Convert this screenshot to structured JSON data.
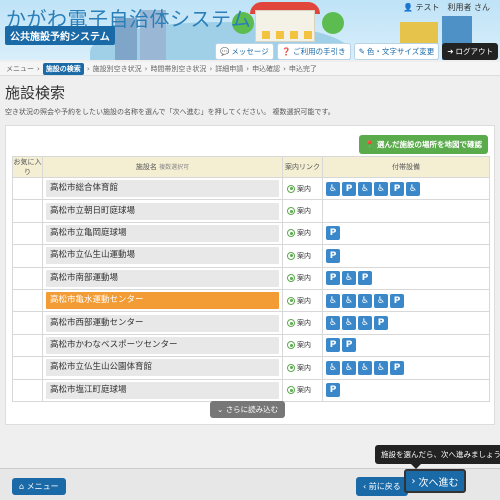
{
  "header": {
    "title": "かがわ電子自治体システム",
    "subtitle": "公共施設予約システム",
    "user": "テスト　利用者 さん",
    "buttons": {
      "message": "メッセージ",
      "notice": "ご利用の手引き",
      "color": "色・文字サイズ変更",
      "logout": "ログアウト"
    }
  },
  "breadcrumb": [
    "メニュー",
    "施設の検索",
    "施設別空き状況",
    "時間帯別空き状況",
    "詳細申請",
    "申込確認",
    "申込完了"
  ],
  "page": {
    "title": "施設検索",
    "instruction": "空き状況の照会や予約をしたい施設の名称を選んで「次へ進む」を押してください。 複数選択可能です。"
  },
  "map_button": "選んだ施設の場所を地図で確認",
  "table": {
    "headers": {
      "fav": "お気に入り",
      "name": "施設名",
      "name_sub": "複数選択可",
      "map": "案内リンク",
      "equipment": "付帯設備"
    },
    "map_link_label": "案内",
    "rows": [
      {
        "name": "高松市総合体育館",
        "equipment": [
          "♿",
          "P",
          "♿",
          "♿",
          "P",
          "♿"
        ],
        "selected": false
      },
      {
        "name": "高松市立朝日町庭球場",
        "equipment": [],
        "selected": false
      },
      {
        "name": "高松市立亀岡庭球場",
        "equipment": [
          "P"
        ],
        "selected": false
      },
      {
        "name": "高松市立仏生山運動場",
        "equipment": [
          "P"
        ],
        "selected": false
      },
      {
        "name": "高松市南部運動場",
        "equipment": [
          "P",
          "♿",
          "P"
        ],
        "selected": false
      },
      {
        "name": "高松市亀水運動センター",
        "equipment": [
          "♿",
          "♿",
          "♿",
          "♿",
          "P"
        ],
        "selected": true
      },
      {
        "name": "高松市西部運動センター",
        "equipment": [
          "♿",
          "♿",
          "♿",
          "P"
        ],
        "selected": false
      },
      {
        "name": "高松市かわなベスポーツセンター",
        "equipment": [
          "P",
          "P"
        ],
        "selected": false
      },
      {
        "name": "高松市立仏生山公園体育館",
        "equipment": [
          "♿",
          "♿",
          "♿",
          "♿",
          "P"
        ],
        "selected": false
      },
      {
        "name": "高松市塩江町庭球場",
        "equipment": [
          "P"
        ],
        "selected": false
      }
    ]
  },
  "more_button": "さらに読み込む",
  "footer": {
    "menu": "メニュー",
    "back": "前に戻る",
    "next": "次へ進む",
    "tooltip": "施設を選んだら、次へ進みましょう。"
  }
}
